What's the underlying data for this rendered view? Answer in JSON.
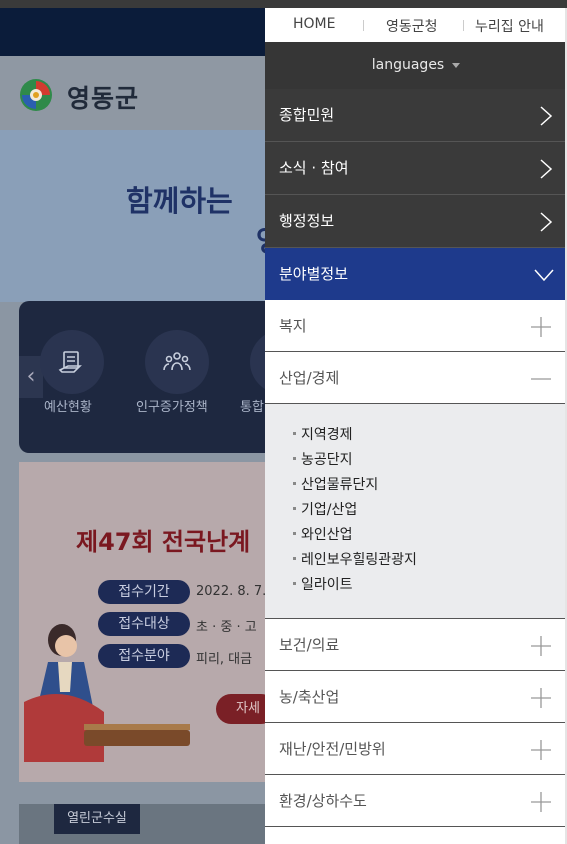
{
  "header": {
    "logo_text": "영동군",
    "slogan_line1": "함께하는",
    "slogan_line2": "영"
  },
  "quick_menu": {
    "items": [
      {
        "label": "예산현황",
        "icon": "budget-icon"
      },
      {
        "label": "인구증가정책",
        "icon": "people-icon"
      },
      {
        "label": "통합",
        "icon": "integrated-icon"
      }
    ]
  },
  "banner": {
    "title": "제47회 전국난계",
    "rows": [
      {
        "label": "접수기간",
        "value": "2022. 8. 7."
      },
      {
        "label": "접수대상",
        "value": "초 · 중 · 고"
      },
      {
        "label": "접수분야",
        "value": "피리, 대금"
      }
    ],
    "detail_button": "자세"
  },
  "bottom_tag": "열린군수실",
  "side_menu": {
    "top_links": [
      "HOME",
      "영동군청",
      "누리집 안내"
    ],
    "languages_label": "languages",
    "main_items": [
      {
        "label": "종합민원",
        "state": "collapsed"
      },
      {
        "label": "소식 · 참여",
        "state": "collapsed"
      },
      {
        "label": "행정정보",
        "state": "collapsed"
      },
      {
        "label": "분야별정보",
        "state": "expanded"
      }
    ],
    "sub_items": [
      {
        "label": "복지",
        "state": "collapsed"
      },
      {
        "label": "산업/경제",
        "state": "expanded"
      },
      {
        "label": "보건/의료",
        "state": "collapsed"
      },
      {
        "label": "농/축산업",
        "state": "collapsed"
      },
      {
        "label": "재난/안전/민방위",
        "state": "collapsed"
      },
      {
        "label": "환경/상하수도",
        "state": "collapsed"
      }
    ],
    "subsub_items": [
      "지역경제",
      "농공단지",
      "산업물류단지",
      "기업/산업",
      "와인산업",
      "레인보우힐링관광지",
      "일라이트"
    ]
  },
  "colors": {
    "active_blue": "#1e3a8c",
    "menu_dark": "#3a3a3a",
    "language_bar": "#363636"
  }
}
